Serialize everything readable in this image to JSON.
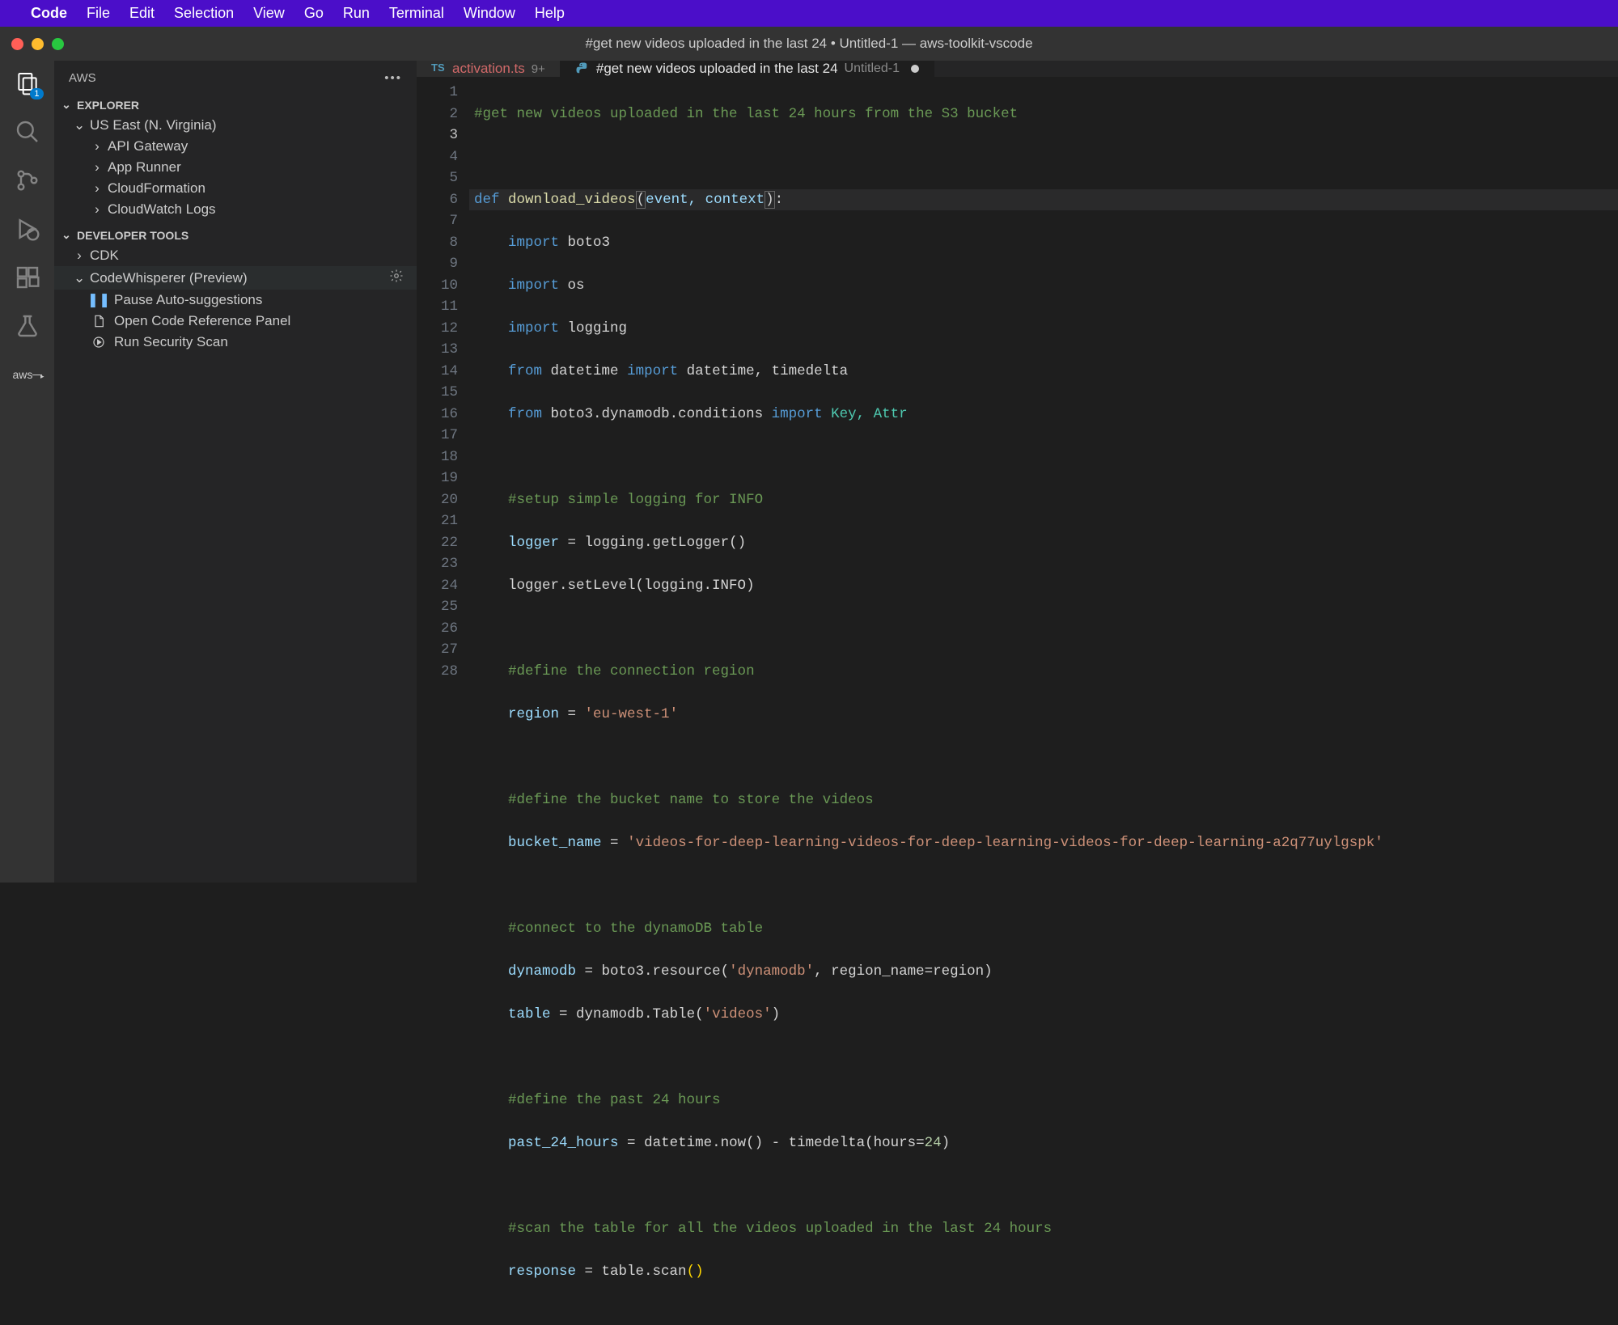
{
  "menubar": {
    "app": "Code",
    "items": [
      "File",
      "Edit",
      "Selection",
      "View",
      "Go",
      "Run",
      "Terminal",
      "Window",
      "Help"
    ]
  },
  "window_title": "#get new videos uploaded in the last 24 • Untitled-1 — aws-toolkit-vscode",
  "activity": {
    "explorer_badge": "1"
  },
  "sidebar": {
    "title": "AWS",
    "explorer_section": "EXPLORER",
    "region": "US East (N. Virginia)",
    "services": [
      "API Gateway",
      "App Runner",
      "CloudFormation",
      "CloudWatch Logs"
    ],
    "dev_tools_section": "DEVELOPER TOOLS",
    "cdk": "CDK",
    "codewhisperer": "CodeWhisperer (Preview)",
    "cw_actions": [
      "Pause Auto-suggestions",
      "Open Code Reference Panel",
      "Run Security Scan"
    ]
  },
  "tabs": {
    "tab1": {
      "name": "activation.ts",
      "badge": "9+"
    },
    "tab2": {
      "name": "#get new videos uploaded in the last 24",
      "subtitle": "Untitled-1"
    }
  },
  "code": {
    "l1_comment": "#get new videos uploaded in the last 24 hours from the S3 bucket",
    "l3_def": "def",
    "l3_name": "download_videos",
    "l3_params": "event, context",
    "l4": "import",
    "l4_mod": "boto3",
    "l5": "import",
    "l5_mod": "os",
    "l6": "import",
    "l6_mod": "logging",
    "l7": "from",
    "l7_mod": "datetime",
    "l7_import": "import",
    "l7_names": "datetime, timedelta",
    "l8": "from",
    "l8_mod": "boto3.dynamodb.conditions",
    "l8_import": "import",
    "l8_names": "Key, Attr",
    "l10_comment": "#setup simple logging for INFO",
    "l11_var": "logger",
    "l11_rhs": "logging.getLogger()",
    "l12": "logger.setLevel(logging.INFO)",
    "l14_comment": "#define the connection region",
    "l15_var": "region",
    "l15_val": "'eu-west-1'",
    "l17_comment": "#define the bucket name to store the videos",
    "l18_var": "bucket_name",
    "l18_val": "'videos-for-deep-learning-videos-for-deep-learning-videos-for-deep-learning-a2q77uylgspk'",
    "l20_comment": "#connect to the dynamoDB table",
    "l21_var": "dynamodb",
    "l21_rhs_a": "boto3.resource(",
    "l21_str": "'dynamodb'",
    "l21_rhs_b": ", region_name=region)",
    "l22_var": "table",
    "l22_rhs_a": "dynamodb.Table(",
    "l22_str": "'videos'",
    "l22_rhs_b": ")",
    "l24_comment": "#define the past 24 hours",
    "l25_var": "past_24_hours",
    "l25_rhs_a": "datetime.now() - timedelta(hours=",
    "l25_num": "24",
    "l25_rhs_b": ")",
    "l27_comment": "#scan the table for all the videos uploaded in the last 24 hours",
    "l28_var": "response",
    "l28_rhs": "table.scan",
    "l28_paren": "()"
  }
}
